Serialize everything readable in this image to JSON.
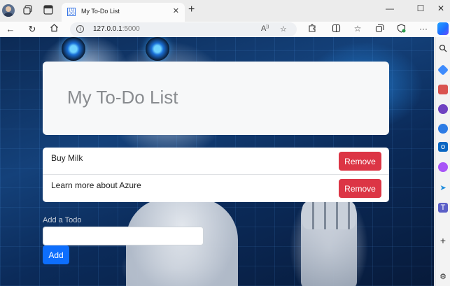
{
  "browser": {
    "tab": {
      "favicon": "TO DO",
      "title": "My To-Do List"
    },
    "address": {
      "host": "127.0.0.1",
      "port": ":5000"
    },
    "window_controls": [
      "minimize",
      "maximize",
      "close"
    ],
    "new_tab_symbol": "+",
    "toolbar_icons": [
      "read-aloud-icon",
      "favorite-star-icon",
      "extensions-icon",
      "split-screen-icon",
      "favorites-icon",
      "collections-icon",
      "browser-essentials-icon",
      "more-icon",
      "copilot-icon"
    ],
    "sidebar_icons": [
      "search-icon",
      "shopping-tag-icon",
      "tools-icon",
      "people-icon",
      "copilot-circle-icon",
      "outlook-icon",
      "designer-icon",
      "telegram-icon",
      "teams-icon",
      "add-icon",
      "settings-icon"
    ]
  },
  "app": {
    "title": "My To-Do List",
    "items": [
      {
        "text": "Buy Milk",
        "action": "Remove"
      },
      {
        "text": "Learn more about Azure",
        "action": "Remove"
      }
    ],
    "add_form": {
      "label": "Add a Todo",
      "input_value": "",
      "submit_label": "Add"
    }
  },
  "colors": {
    "remove_button": "#dc3545",
    "add_button": "#0d6efd",
    "title_text": "#888b8f"
  }
}
